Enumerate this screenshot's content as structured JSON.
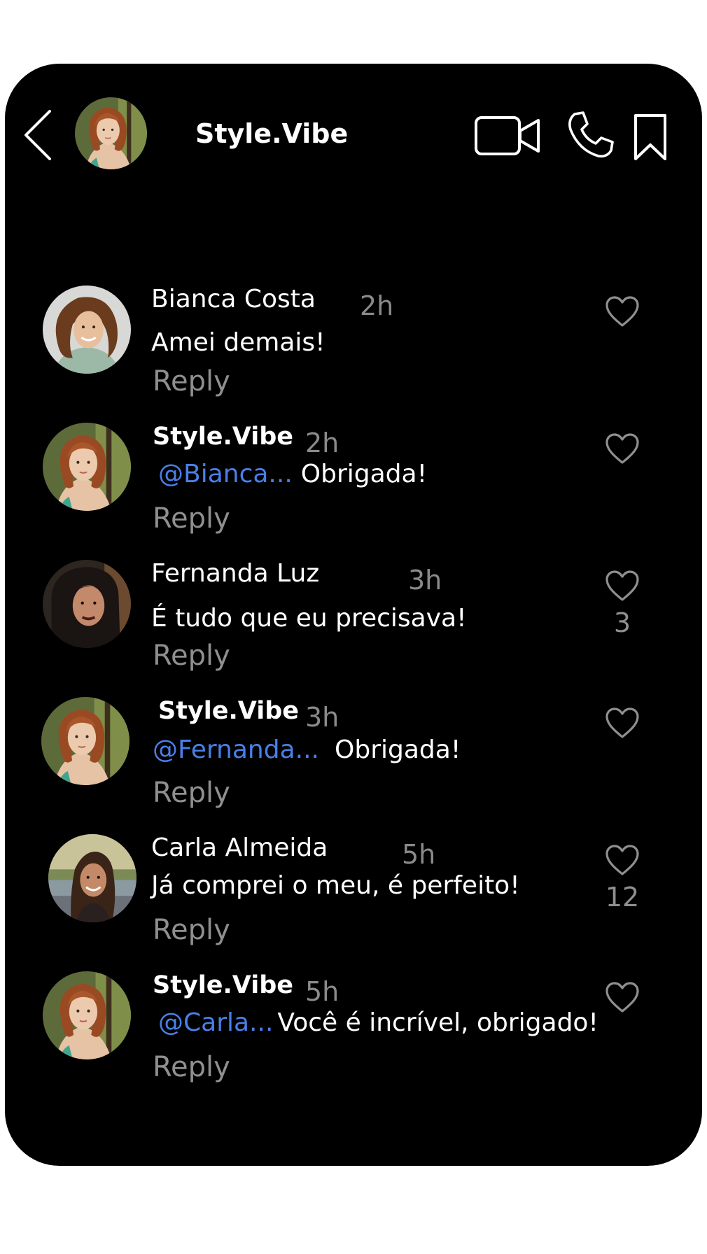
{
  "header": {
    "title": "Style.Vibe",
    "icons": [
      "back-icon",
      "video-call-icon",
      "phone-icon",
      "bookmark-icon"
    ]
  },
  "comments": [
    {
      "author": "Bianca Costa",
      "time": "2h",
      "mention": "",
      "text": "Amei demais!",
      "reply_label": "Reply",
      "likes": ""
    },
    {
      "author": "Style.Vibe",
      "time": "2h",
      "mention": "@Bianca...",
      "text": "Obrigada!",
      "reply_label": "Reply",
      "likes": ""
    },
    {
      "author": "Fernanda Luz",
      "time": "3h",
      "mention": "",
      "text": "É tudo que eu precisava!",
      "reply_label": "Reply",
      "likes": "3"
    },
    {
      "author": "Style.Vibe",
      "time": "3h",
      "mention": "@Fernanda...",
      "text": "Obrigada!",
      "reply_label": "Reply",
      "likes": ""
    },
    {
      "author": "Carla Almeida",
      "time": "5h",
      "mention": "",
      "text": "Já comprei o meu, é perfeito!",
      "reply_label": "Reply",
      "likes": "12"
    },
    {
      "author": "Style.Vibe",
      "time": "5h",
      "mention": "@Carla...",
      "text": "Você é incrível, obrigado!",
      "reply_label": "Reply",
      "likes": ""
    }
  ],
  "colors": {
    "background": "#000000",
    "text": "#ffffff",
    "muted": "#8f8f8f",
    "mention": "#4a7fe8"
  }
}
